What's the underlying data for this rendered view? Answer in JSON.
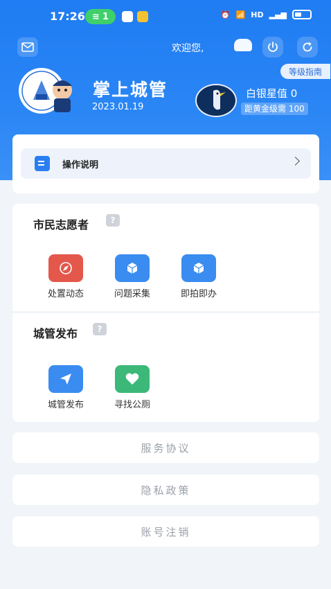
{
  "status_bar": {
    "time": "17:26",
    "pill_count": "1",
    "right_labels": [
      "HD"
    ]
  },
  "header": {
    "welcome": "欢迎您,",
    "level_guide": "等级指南",
    "app_name": "掌上城管",
    "date": "2023.01.19",
    "rank": "白银星值 0",
    "rank_next": "距黄金级需 100"
  },
  "guide": {
    "label": "操作说明"
  },
  "volunteer": {
    "title": "市民志愿者",
    "help": "?",
    "items": [
      {
        "label": "处置动态",
        "icon": "compass-icon",
        "color": "#e4574b"
      },
      {
        "label": "问题采集",
        "icon": "box-icon",
        "color": "#3a8cf0"
      },
      {
        "label": "即拍即办",
        "icon": "box-icon",
        "color": "#3a8cf0"
      }
    ]
  },
  "publish": {
    "title": "城管发布",
    "help": "?",
    "items": [
      {
        "label": "城管发布",
        "icon": "paper-plane-icon",
        "color": "#3a8cf0"
      },
      {
        "label": "寻找公厕",
        "icon": "heart-icon",
        "color": "#3cb878"
      }
    ]
  },
  "links": [
    {
      "label": "服务协议"
    },
    {
      "label": "隐私政策"
    },
    {
      "label": "账号注销"
    }
  ],
  "colors": {
    "header_blue": "#1f7cf2",
    "accent": "#2a7ff0",
    "background": "#f1f4f8"
  }
}
